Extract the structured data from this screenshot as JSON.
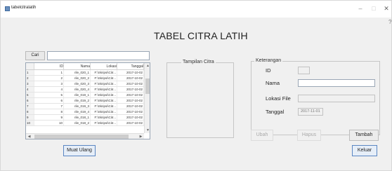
{
  "window": {
    "title": "tabelcitralatih",
    "minimize": "–",
    "maximize": "□",
    "close": "✕",
    "help": "?"
  },
  "main_title": "TABEL CITRA LATIH",
  "search": {
    "button_label": "Cari",
    "value": ""
  },
  "table": {
    "headers": [
      "",
      "ID",
      "Nama",
      "Lokasi",
      "Tanggal"
    ],
    "rows": [
      [
        "1",
        "1",
        "rile_020_1",
        "F:\\Skripsi\\Citr...",
        "2017-10-02"
      ],
      [
        "2",
        "2",
        "rile_020_2",
        "F:\\Skripsi\\Citr...",
        "2017-10-02"
      ],
      [
        "3",
        "3",
        "rile_020_3",
        "F:\\Skripsi\\Citr...",
        "2017-10-02"
      ],
      [
        "4",
        "4",
        "rile_020_4",
        "F:\\Skripsi\\Citr...",
        "2017-10-02"
      ],
      [
        "5",
        "5",
        "rile_019_1",
        "F:\\Skripsi\\Citr...",
        "2017-10-02"
      ],
      [
        "6",
        "6",
        "rile_019_2",
        "F:\\Skripsi\\Citr...",
        "2017-10-02"
      ],
      [
        "7",
        "7",
        "rile_019_3",
        "F:\\Skripsi\\Citr...",
        "2017-10-02"
      ],
      [
        "8",
        "8",
        "rile_019_4",
        "F:\\Skripsi\\Citr...",
        "2017-10-02"
      ],
      [
        "9",
        "9",
        "rile_018_1",
        "F:\\Skripsi\\Citr...",
        "2017-10-02"
      ],
      [
        "10",
        "10",
        "rile_018_2",
        "F:\\Skripsi\\Citr...",
        "2017-10-02"
      ]
    ],
    "scroll_up": "▲",
    "scroll_down": "▼",
    "scroll_left": "◀",
    "scroll_right": "▶"
  },
  "reload_button": "Muat Ulang",
  "image_panel": {
    "label": "Tampilan Citra"
  },
  "info_panel": {
    "label": "Keterangan",
    "id_label": "ID",
    "id_value": "",
    "name_label": "Nama",
    "name_value": "",
    "file_label": "Lokasi File",
    "file_value": "",
    "date_label": "Tanggal",
    "date_value": "2017-11-01"
  },
  "actions": {
    "edit": "Ubah",
    "delete": "Hapus",
    "add": "Tambah",
    "exit": "Keluar"
  },
  "colors": {
    "window_bg": "#f0f0f0",
    "focus_border": "#5a86c2",
    "disabled_text": "#a9a9a9"
  }
}
